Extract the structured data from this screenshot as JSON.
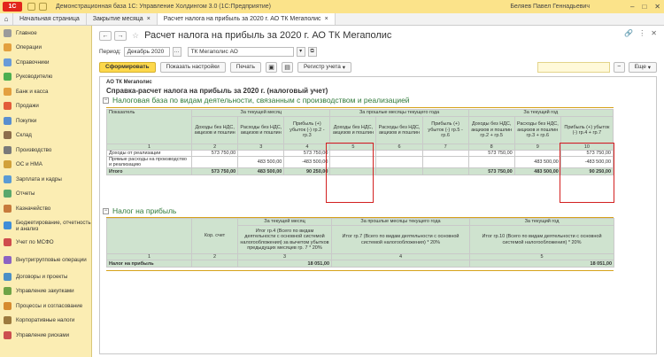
{
  "titlebar": {
    "app_title": "Демонстрационная база 1С: Управление Холдингом 3.0  (1С:Предприятие)",
    "user": "Беляев Павел Геннадьевич"
  },
  "tabs": [
    {
      "label": "Начальная страница"
    },
    {
      "label": "Закрытие месяца"
    },
    {
      "label": "Расчет налога на прибыль за 2020 г. АО ТК Мегаполис"
    }
  ],
  "sidebar": [
    {
      "label": "Главное",
      "color": "#9b9b9b"
    },
    {
      "label": "Операции",
      "color": "#e3a03f"
    },
    {
      "label": "Справочники",
      "color": "#6a9bd8"
    },
    {
      "label": "Руководителю",
      "color": "#4caf50"
    },
    {
      "label": "Банк и касса",
      "color": "#e3a03f"
    },
    {
      "label": "Продажи",
      "color": "#e35d3a"
    },
    {
      "label": "Покупки",
      "color": "#5a8fcf"
    },
    {
      "label": "Склад",
      "color": "#8d6e4c"
    },
    {
      "label": "Производство",
      "color": "#7a7a7a"
    },
    {
      "label": "ОС и НМА",
      "color": "#d1a13a"
    },
    {
      "label": "Зарплата и кадры",
      "color": "#5a9bd4"
    },
    {
      "label": "Отчеты",
      "color": "#5aa86c"
    },
    {
      "label": "Казначейство",
      "color": "#c77b3c"
    },
    {
      "label": "Бюджетирование, отчетность и анализ",
      "color": "#3f8ed8",
      "tall": true
    },
    {
      "label": "Учет по МСФО",
      "color": "#cf4d4d"
    },
    {
      "label": "Внутригрупповые операции",
      "color": "#8c63c2",
      "tall": true
    },
    {
      "label": "Договоры и проекты",
      "color": "#4b8fc6"
    },
    {
      "label": "Управление закупками",
      "color": "#6fa346"
    },
    {
      "label": "Процессы и согласование",
      "color": "#d68b2f"
    },
    {
      "label": "Корпоративные налоги",
      "color": "#9c7a3e"
    },
    {
      "label": "Управление рисками",
      "color": "#cc4f4f"
    }
  ],
  "page": {
    "title": "Расчет налога на прибыль за 2020 г. АО ТК Мегаполис"
  },
  "filters": {
    "period_label": "Период:",
    "period_value": "Декабрь 2020",
    "org_value": "ТК Мегаполис АО"
  },
  "toolbar": {
    "generate": "Сформировать",
    "show_settings": "Показать настройки",
    "print": "Печать",
    "registry": "Регистр учета",
    "more": "Еще"
  },
  "report": {
    "org": "АО ТК Мегаполис",
    "title": "Справка-расчет налога на прибыль за 2020 г. (налоговый учет)",
    "section1": {
      "title": "Налоговая база по видам деятельности, связанным с производством и реализацией",
      "indicator_header": "Показатель",
      "period_current_month": "За текущей месяц",
      "period_prev_months": "За прошлые месяцы текущего года",
      "period_current_year": "За текущий год",
      "col_income": "Доходы без НДС, акцизов и пошлин",
      "col_expense": "Расходы без НДС, акцизов и пошлин",
      "col_profit_m": "Прибыль (+) убыток (-) гр.2 - гр.3",
      "col_profit_p": "Прибыль (+) убыток (-) гр.5 - гр.6",
      "col_income_y": "Доходы без НДС, акцизов и пошлин гр.2 + гр.5",
      "col_expense_y": "Расходы без НДС, акцизов и пошлин гр.3 + гр.6",
      "col_profit_y": "Прибыль (+) убыток (-) гр.4 + гр.7",
      "nums": [
        "1",
        "2",
        "3",
        "4",
        "5",
        "6",
        "7",
        "8",
        "9",
        "10"
      ],
      "rows": [
        {
          "label": "Доходы от реализации",
          "c2": "573 750,00",
          "c3": "",
          "c4": "573 750,00",
          "c5": "",
          "c6": "",
          "c7": "",
          "c8": "573 750,00",
          "c9": "",
          "c10": "573 750,00"
        },
        {
          "label": "Прямые расходы на производство и реализацию",
          "c2": "",
          "c3": "483 500,00",
          "c4": "-483 500,00",
          "c5": "",
          "c6": "",
          "c7": "",
          "c8": "",
          "c9": "483 500,00",
          "c10": "-483 500,00"
        }
      ],
      "total": {
        "label": "Итого",
        "c2": "573 750,00",
        "c3": "483 500,00",
        "c4": "90 250,00",
        "c5": "",
        "c6": "",
        "c7": "",
        "c8": "573 750,00",
        "c9": "483 500,00",
        "c10": "90 250,00"
      }
    },
    "section2": {
      "title": "Налог на прибыль",
      "col_account": "Кор. счет",
      "period_current_month": "За текущей месяц",
      "period_prev_months": "За прошлые месяцы текущего года",
      "period_current_year": "За текущий год",
      "col_m": "Итог гр.4 (Всего по видам деятельности с основной системой налогообложения) за вычетом убытков предыдущих месяцев гр. 7 * 20%",
      "col_p": "Итог гр.7 (Всего по видам деятельности с основной системой налогообложения) * 20%",
      "col_y": "Итог гр.10 (Всего по видам деятельности с основной системой налогообложения) * 20%",
      "nums": [
        "1",
        "2",
        "3",
        "4",
        "5"
      ],
      "total": {
        "label": "Налог на прибыль",
        "c3": "18 051,00",
        "c4": "",
        "c5": "18 051,00"
      }
    }
  }
}
